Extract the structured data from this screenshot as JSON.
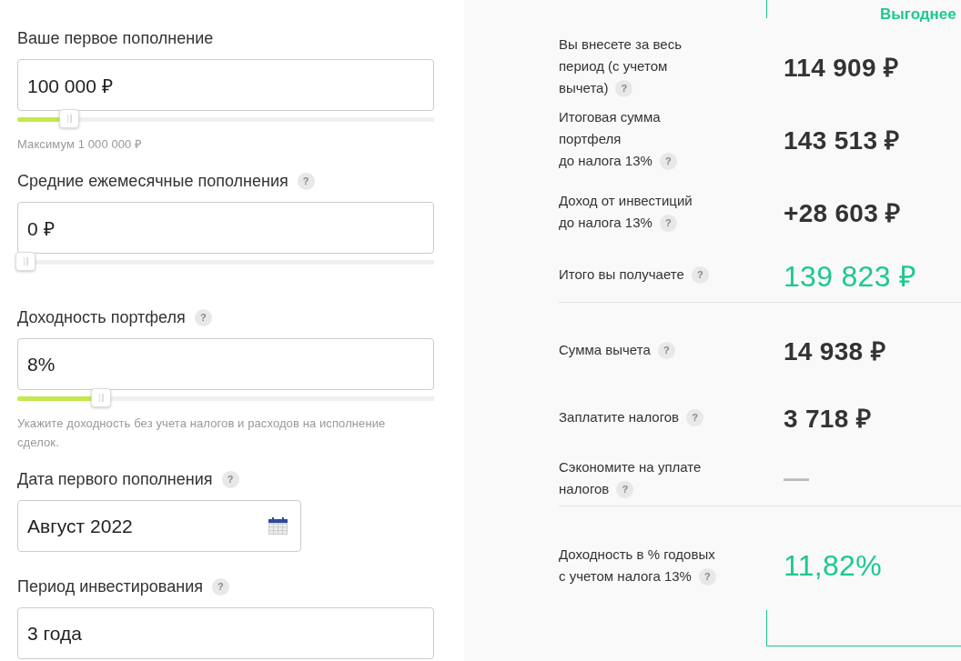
{
  "inputs": [
    {
      "kind": "slider",
      "label": "Ваше первое пополнение",
      "value": "100 000 ₽",
      "level": 0.11,
      "hint": "Максимум 1 000 000 ₽"
    },
    {
      "kind": "slider",
      "label": "Средние ежемесячные пополнения",
      "help": "?",
      "value": "0 ₽",
      "level": 0
    },
    {
      "kind": "slider",
      "label": "Доходность портфеля",
      "help": "?",
      "value": "8%",
      "level": 0.19,
      "hint": "Укажите доходность без учета налогов и расходов на исполнение сделок."
    },
    {
      "kind": "date",
      "label": "Дата первого пополнения",
      "help": "?",
      "value": "Август 2022"
    },
    {
      "kind": "text",
      "label": "Период инвестирования",
      "help": "?",
      "value": "3 года"
    }
  ],
  "results": {
    "column_title": "Выгоднее",
    "sections": [
      {
        "rows": [
          {
            "label": [
              "Вы внесете за весь",
              "период (с учетом",
              "вычета)"
            ],
            "help": "?",
            "value": "114 909 ₽",
            "kind": "normal"
          },
          {
            "label": [
              "Итоговая сумма",
              "портфеля",
              "до налога 13%"
            ],
            "help": "?",
            "value": "143 513 ₽",
            "kind": "normal"
          },
          {
            "label": [
              "Доход от инвестиций",
              "до налога 13%"
            ],
            "help": "?",
            "value": "+28 603 ₽",
            "kind": "normal"
          },
          {
            "label": [
              "Итого вы получаете"
            ],
            "help": "?",
            "value": "139 823 ₽",
            "kind": "accent"
          }
        ]
      },
      {
        "rows": [
          {
            "label": [
              "Сумма вычета"
            ],
            "help": "?",
            "value": "14 938 ₽",
            "kind": "normal"
          },
          {
            "label": [
              "Заплатите налогов"
            ],
            "help": "?",
            "value": "3 718 ₽",
            "kind": "normal"
          },
          {
            "label": [
              "Сэкономите на уплате",
              "налогов"
            ],
            "help": "?",
            "value": "—",
            "kind": "muted"
          }
        ]
      },
      {
        "rows": [
          {
            "label": [
              "Доходность в % годовых",
              "с учетом налога 13%"
            ],
            "help": "?",
            "value": "11,82%",
            "kind": "accent"
          }
        ]
      }
    ]
  }
}
